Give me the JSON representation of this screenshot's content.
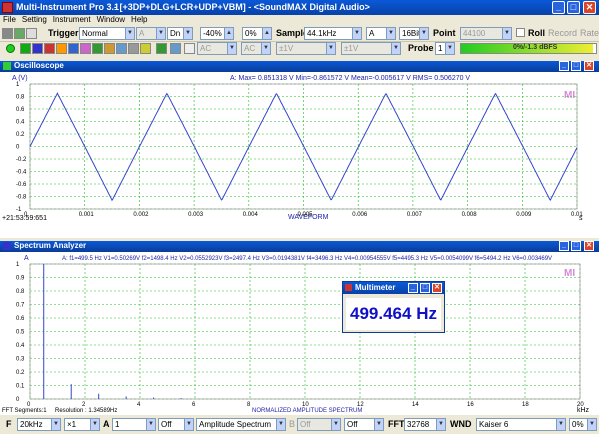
{
  "window": {
    "title": "Multi-Instrument Pro 3.1",
    "subtitle": "- [+3DP+DLG+LCR+UDP+VBM] - <SoundMAX Digital Audio>",
    "min": "_",
    "max": "□",
    "close": "✕"
  },
  "menu": [
    "File",
    "Setting",
    "Instrument",
    "Window",
    "Help"
  ],
  "toolbar1": {
    "trigger_label": "Trigger",
    "trigger_mode": "Normal",
    "channel": "A",
    "edge": "Dn",
    "level": "-40%",
    "delay": "0%",
    "sample_label": "Sample",
    "sample_rate": "44.1kHz",
    "sample_channel": "A",
    "bits": "16Bit",
    "point_label": "Point",
    "points": "44100",
    "roll_label": "Roll",
    "record_label": "Record",
    "rate_label": "Rate"
  },
  "toolbar2": {
    "ac1": "AC",
    "ac2": "AC",
    "v1": "±1V",
    "v2": "±1V",
    "probe_label": "Probe",
    "probe": "1",
    "progress_text": "0%/-1.3 dBFS",
    "progress_fraction": 0.98
  },
  "oscilloscope": {
    "title": "Oscilloscope",
    "ylabel": "A (V)",
    "stats": "A: Max= 0.851318 V  Min=-0.861572 V  Mean=-0.005617 V  RMS= 0.506270 V",
    "timestamp": "+21:53:59:651",
    "xlabel": "WAVEFORM",
    "x_unit": "s",
    "watermark": "MI",
    "color": "#3344cc"
  },
  "spectrum": {
    "title": "Spectrum Analyzer",
    "ylabel": "A",
    "stats": "A: f1=499.5 Hz  V1=0.50269V  f2=1498.4 Hz  V2=0.0552923V  f3=2497.4 Hz  V3=0.0194381V  f4=3496.3 Hz  V4=0.00954555V  f5=4495.3 Hz  V5=0.0054099V  f6=5494.2 Hz  V6=0.003469V",
    "segments": "FFT Segments:1",
    "resolution": "Resolution : 1.34589Hz",
    "xlabel": "NORMALIZED AMPLITUDE SPECTRUM",
    "x_unit": "kHz",
    "watermark": "MI"
  },
  "multimeter": {
    "title": "Multimeter",
    "value": "499.464 Hz"
  },
  "statusbar": {
    "f_label": "F",
    "freq_range": "20kHz",
    "zoom": "×1",
    "a_label": "A",
    "a_val": "1",
    "off1": "Off",
    "spectrum_type": "Amplitude Spectrum",
    "b_label": "B",
    "b_off": "Off",
    "off2": "Off",
    "fft_label": "FFT",
    "fft_size": "32768",
    "wnd_label": "WND",
    "window": "Kaiser 6",
    "overlap": "0%"
  },
  "chart_data": [
    {
      "type": "line",
      "title": "Oscilloscope",
      "ylabel": "A (V)",
      "xlabel": "WAVEFORM",
      "xlim": [
        0,
        0.01
      ],
      "ylim": [
        -1,
        1
      ],
      "x_ticks": [
        "0",
        "0.001",
        "0.002",
        "0.003",
        "0.004",
        "0.005",
        "0.006",
        "0.007",
        "0.008",
        "0.009",
        "0.01"
      ],
      "y_ticks": [
        "1",
        "0.8",
        "0.6",
        "0.4",
        "0.2",
        "0",
        "-0.2",
        "-0.4",
        "-0.6",
        "-0.8",
        "-1"
      ],
      "series": [
        {
          "name": "A",
          "waveform": "triangle",
          "frequency_hz": 499.464,
          "max": 0.851318,
          "min": -0.861572,
          "phase_start": 0.0
        }
      ],
      "grid": true
    },
    {
      "type": "bar",
      "title": "Spectrum Analyzer",
      "xlabel": "NORMALIZED AMPLITUDE SPECTRUM",
      "xlim": [
        0,
        20
      ],
      "ylim": [
        0,
        1
      ],
      "x_ticks": [
        "0",
        "2",
        "4",
        "6",
        "8",
        "10",
        "12",
        "14",
        "16",
        "18",
        "20"
      ],
      "y_ticks": [
        "1",
        "0.9",
        "0.8",
        "0.7",
        "0.6",
        "0.5",
        "0.4",
        "0.3",
        "0.2",
        "0.1",
        "0"
      ],
      "series": [
        {
          "name": "A",
          "x": [
            0.4995,
            1.4984,
            2.4974,
            3.4963,
            4.4953,
            5.4942
          ],
          "values": [
            1.0,
            0.11,
            0.0387,
            0.019,
            0.0108,
            0.0069
          ]
        }
      ],
      "grid": true
    }
  ]
}
